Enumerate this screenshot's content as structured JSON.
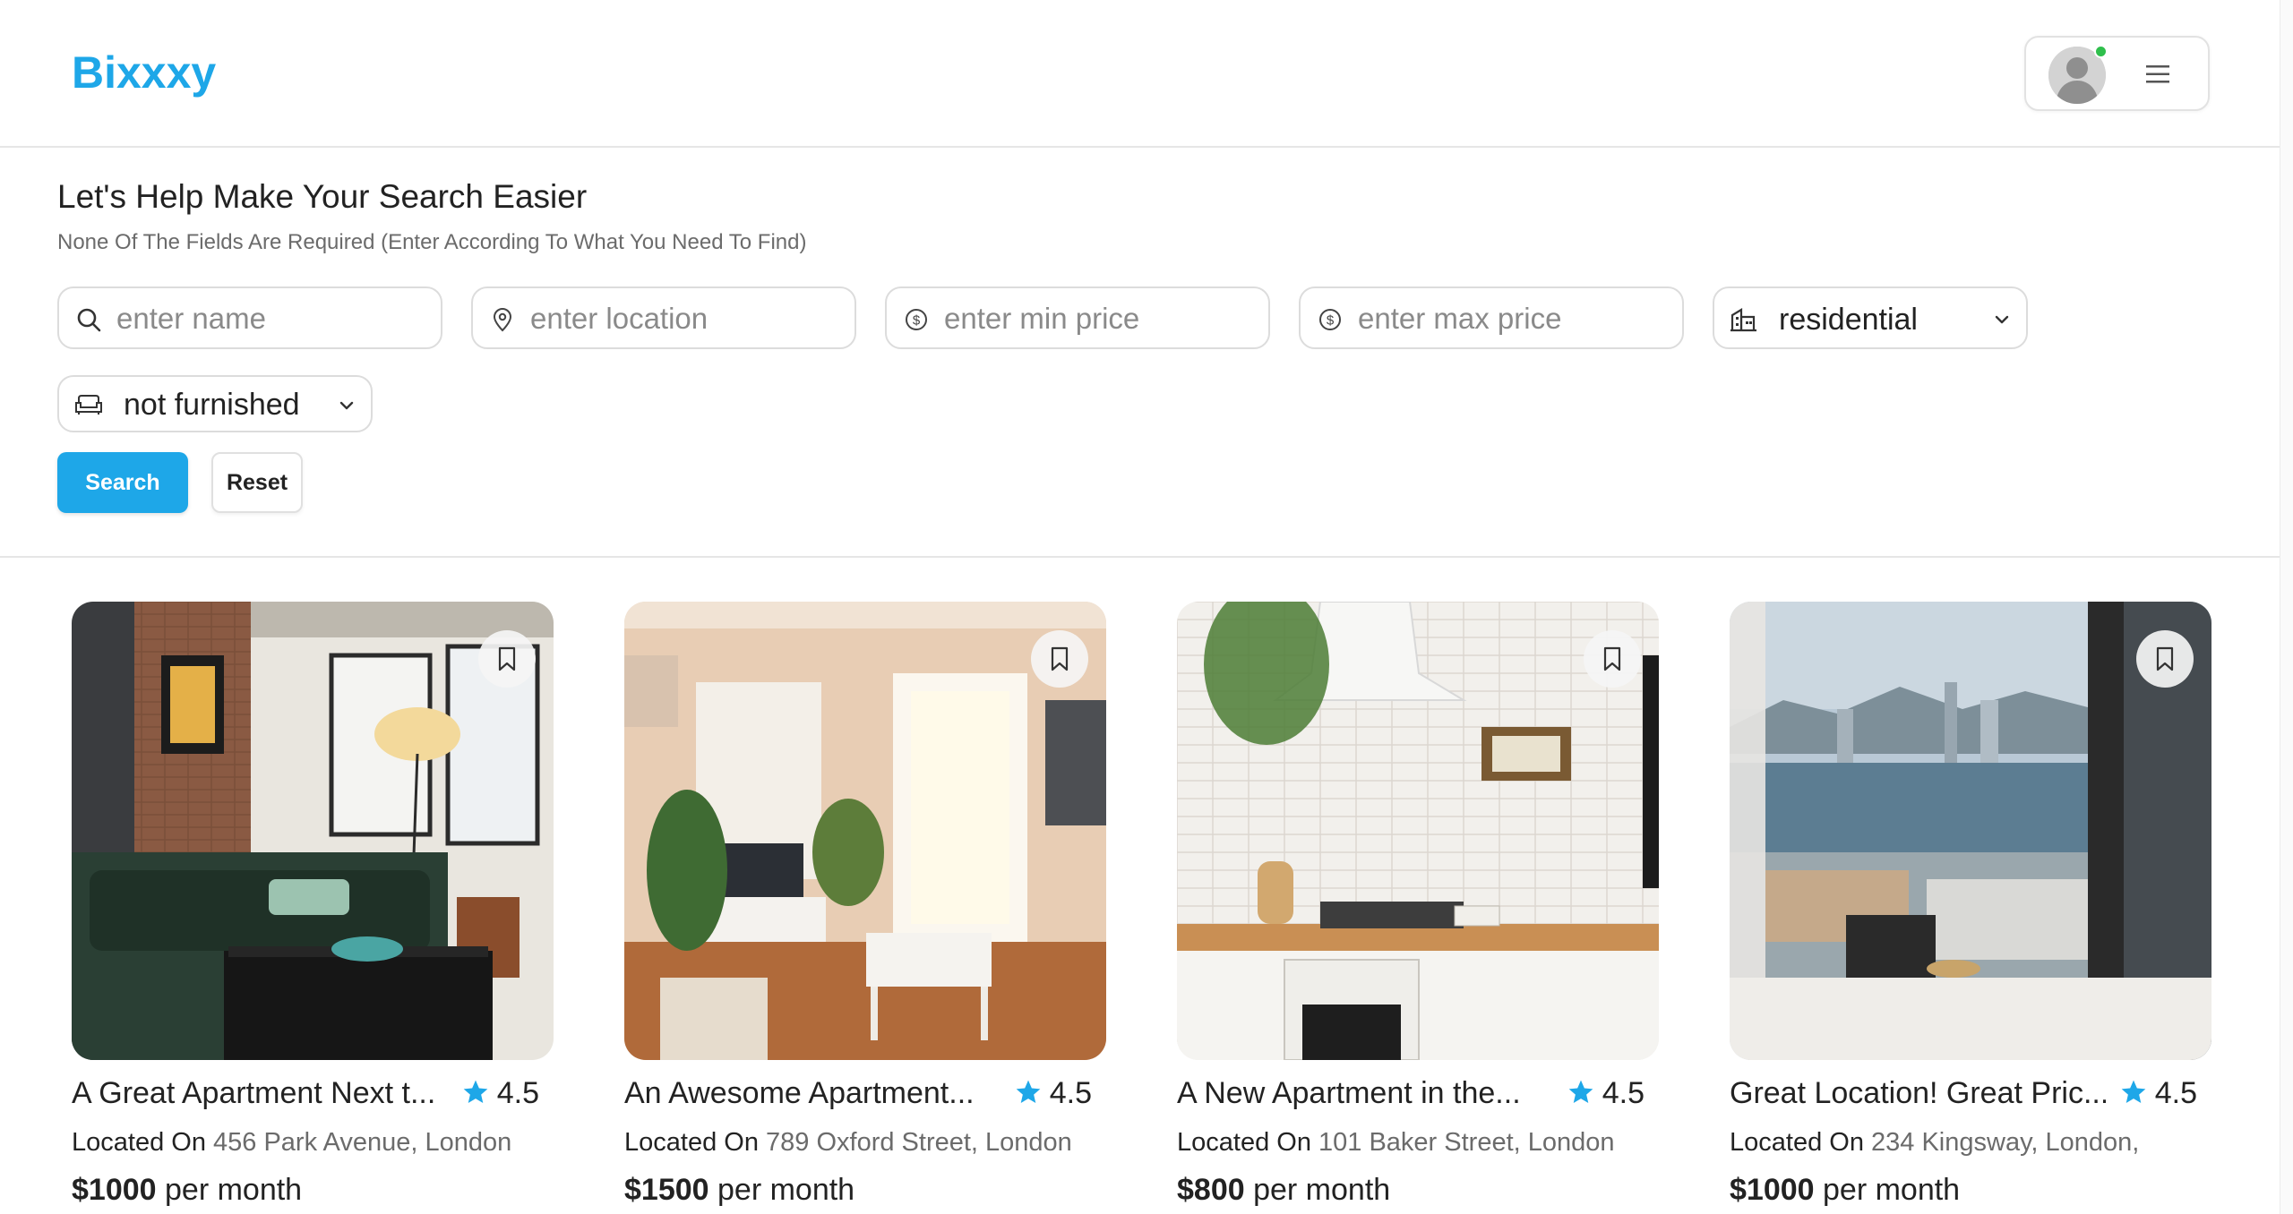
{
  "header": {
    "logo": "Bixxxy",
    "accent_color": "#1ea7e8",
    "avatar_icon": "user-avatar-icon",
    "online_status_color": "#2fbf4c",
    "menu_icon": "hamburger-menu-icon"
  },
  "search": {
    "title": "Let's Help Make Your Search Easier",
    "subtitle": "None Of The Fields Are Required (Enter According To What You Need To Find)",
    "name_placeholder": "enter name",
    "location_placeholder": "enter location",
    "min_price_placeholder": "enter min price",
    "max_price_placeholder": "enter max price",
    "property_type": "residential",
    "furnishing": "not furnished",
    "search_label": "Search",
    "reset_label": "Reset"
  },
  "listings": [
    {
      "name": "A Great Apartment Next t...",
      "rating": "4.5",
      "located_label": "Located On",
      "address": "456 Park Avenue, London",
      "price": "$1000",
      "period": "per month"
    },
    {
      "name": "An Awesome Apartment...",
      "rating": "4.5",
      "located_label": "Located On",
      "address": "789 Oxford Street, London",
      "price": "$1500",
      "period": "per month"
    },
    {
      "name": "A New Apartment in the...",
      "rating": "4.5",
      "located_label": "Located On",
      "address": "101 Baker Street, London",
      "price": "$800",
      "period": "per month"
    },
    {
      "name": "Great Location! Great Pric...",
      "rating": "4.5",
      "located_label": "Located On",
      "address": "234 Kingsway, London,",
      "price": "$1000",
      "period": "per month"
    }
  ]
}
